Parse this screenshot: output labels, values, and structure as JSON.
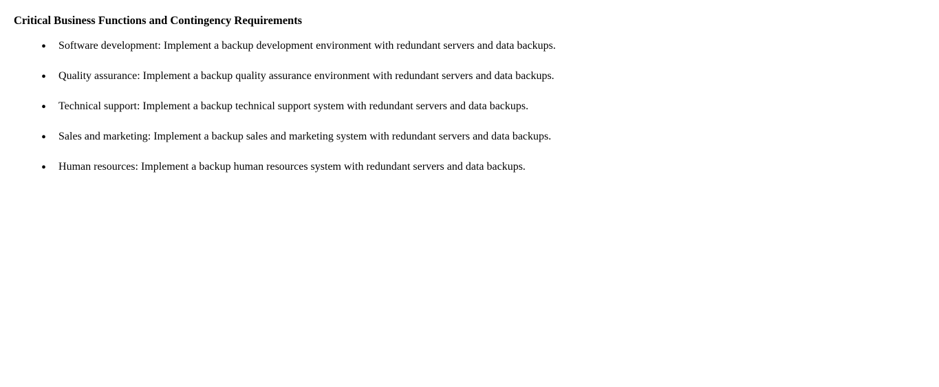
{
  "heading": "Critical Business Functions and Contingency Requirements",
  "items": [
    {
      "id": "software-development",
      "text": "Software development: Implement a backup development environment with redundant servers and data backups."
    },
    {
      "id": "quality-assurance",
      "text": "Quality assurance: Implement a backup quality assurance environment with redundant servers and data backups."
    },
    {
      "id": "technical-support",
      "text": "Technical support: Implement a backup technical support system with redundant servers and data backups."
    },
    {
      "id": "sales-marketing",
      "text": "Sales and marketing: Implement a backup sales and marketing system with redundant servers and data backups."
    },
    {
      "id": "human-resources",
      "text": "Human resources: Implement a backup human resources system with redundant servers and data backups."
    }
  ]
}
